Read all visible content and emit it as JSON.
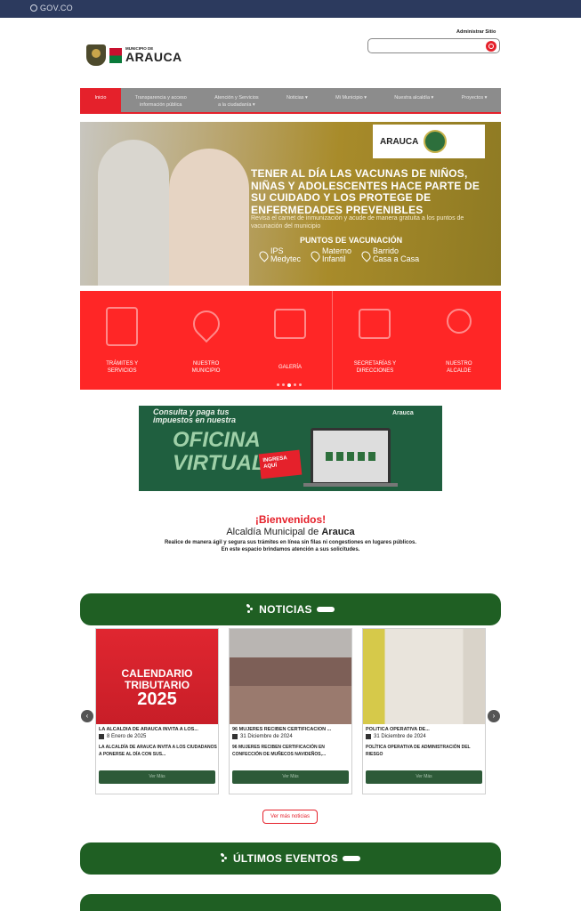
{
  "gov": {
    "label": "GOV.CO"
  },
  "header": {
    "admin_link": "Administrar Sitio",
    "search_placeholder": "",
    "logo_small": "MUNICIPIO DE",
    "logo_big": "ARAUCA"
  },
  "nav": {
    "items": [
      {
        "label": "Inicio"
      },
      {
        "label": "Transparencia y acceso",
        "label2": "información pública"
      },
      {
        "label": "Atención y Servicios",
        "label2": "a la ciudadanía ▾"
      },
      {
        "label": "Noticias ▾"
      },
      {
        "label": "Mi Municipio ▾"
      },
      {
        "label": "Nuestra alcaldía ▾"
      },
      {
        "label": "Proyectos ▾"
      }
    ]
  },
  "hero": {
    "badge_text": "ARAUCA",
    "headline": "TENER AL DÍA LAS VACUNAS DE NIÑOS, NIÑAS Y ADOLESCENTES HACE PARTE DE SU CUIDADO Y LOS PROTEGE DE ENFERMEDADES PREVENIBLES",
    "subtext": "Revisa el carnet de inmunización y acude de manera gratuita a los puntos de vacunación del municipio",
    "points_title": "PUNTOS DE VACUNACIÓN",
    "points": [
      {
        "line1": "IPS",
        "line2": "Medytec"
      },
      {
        "line1": "Materno",
        "line2": "Infantil"
      },
      {
        "line1": "Barrido",
        "line2": "Casa a Casa"
      }
    ]
  },
  "quick_links": [
    {
      "icon": "document-icon",
      "line1": "TRÁMITES Y",
      "line2": "SERVICIOS"
    },
    {
      "icon": "location-pin-icon",
      "line1": "NUESTRO",
      "line2": "MUNICIPIO"
    },
    {
      "icon": "gallery-icon",
      "line1": "GALERÍA",
      "line2": ""
    },
    {
      "icon": "monitor-icon",
      "line1": "SECRETARÍAS Y",
      "line2": "DIRECCIONES"
    },
    {
      "icon": "person-icon",
      "line1": "NUESTRO",
      "line2": "ALCALDE"
    }
  ],
  "banner": {
    "line1": "Consulta y paga tus",
    "line2": "impuestos en nuestra",
    "title1": "OFICINA",
    "title2": "VIRTUAL",
    "tag1": "INGRESA",
    "tag2": "AQUÍ",
    "logo": "Arauca"
  },
  "welcome": {
    "title": "¡Bienvenidos!",
    "subtitle_a": "Alcaldía Municipal de ",
    "subtitle_b": "Arauca",
    "line1": "Realice de manera ágil y segura sus trámites en línea sin filas ni congestiones en lugares públicos.",
    "line2": "En este espacio brindamos atención a sus solicitudes."
  },
  "news": {
    "heading": "NOTICIAS",
    "items": [
      {
        "title": "LA ALCALDÍA DE ARAUCA INVITA A LOS...",
        "date": "8 Enero de 2025",
        "desc": "LA ALCALDÍA DE ARAUCA INVITA A LOS CIUDADANOS A PONERSE AL DÍA CON SUS...",
        "button": "Ver Más",
        "img_title1": "CALENDARIO",
        "img_title2": "TRIBUTARIO",
        "img_year": "2025"
      },
      {
        "title": "96 MUJERES RECIBEN CERTIFICACIÓN ...",
        "date": "31 Diciembre de 2024",
        "desc": "96 MUJERES RECIBEN CERTIFICACIÓN EN CONFECCIÓN DE MUÑECOS NAVIDEÑOS,...",
        "button": "Ver Más"
      },
      {
        "title": "POLÍTICA OPERATIVA DE...",
        "date": "31 Diciembre de 2024",
        "desc": "POLÍTICA OPERATIVA DE ADMINISTRACIÓN DEL RIESGO",
        "button": "Ver Más"
      }
    ],
    "more_button": "Ver más noticias"
  },
  "events": {
    "heading": "ÚLTIMOS EVENTOS"
  },
  "colors": {
    "red": "#e5212b",
    "green": "#1f5f23",
    "navy": "#2c3a5e"
  }
}
